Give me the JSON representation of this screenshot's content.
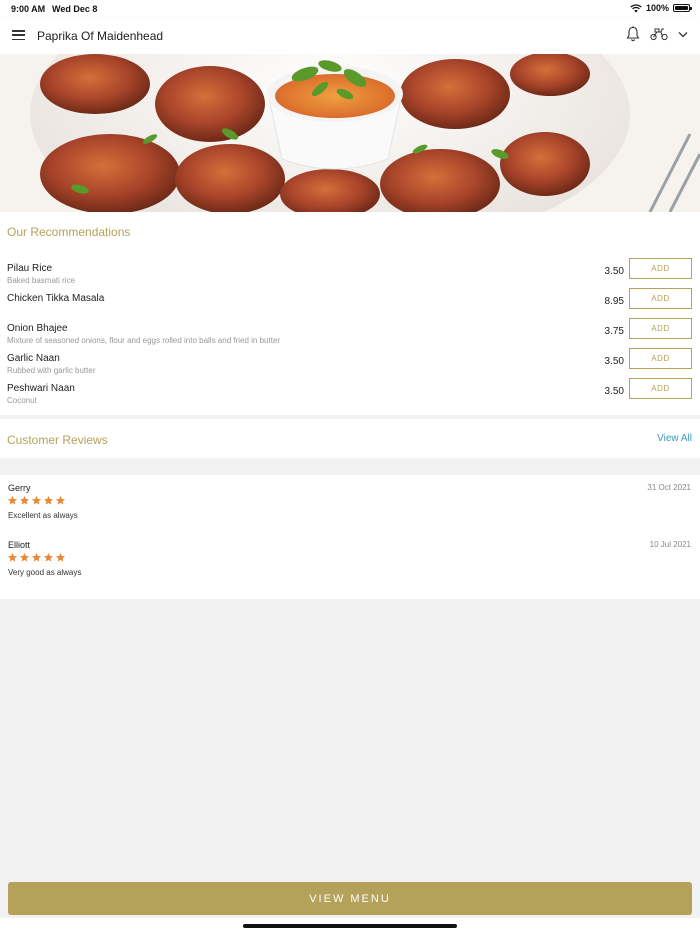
{
  "status": {
    "time": "9:00 AM",
    "date": "Wed Dec 8",
    "battery": "100%"
  },
  "header": {
    "title": "Paprika Of Maidenhead"
  },
  "recommendations": {
    "title": "Our Recommendations",
    "add_label": "ADD",
    "items": [
      {
        "name": "Pilau Rice",
        "desc": "Baked basmati rice",
        "price": "3.50"
      },
      {
        "name": "Chicken Tikka Masala",
        "desc": "",
        "price": "8.95"
      },
      {
        "name": "Onion Bhajee",
        "desc": "Mixture of seasoned onions, flour and eggs rolled into balls and fried in butter",
        "price": "3.75"
      },
      {
        "name": "Garlic Naan",
        "desc": "Rubbed with garlic butter",
        "price": "3.50"
      },
      {
        "name": "Peshwari Naan",
        "desc": "Coconut",
        "price": "3.50"
      }
    ]
  },
  "reviews": {
    "title": "Customer Reviews",
    "view_all": "View All",
    "items": [
      {
        "name": "Gerry",
        "date": "31 Oct 2021",
        "rating": 5,
        "text": "Excellent as always"
      },
      {
        "name": "Elliott",
        "date": "10 Jul 2021",
        "rating": 5,
        "text": "Very good as always"
      }
    ]
  },
  "footer": {
    "view_menu": "VIEW MENU"
  },
  "colors": {
    "accent": "#b5a25a",
    "link": "#3a9cc0",
    "star": "#e8893a"
  },
  "icons": [
    "menu-icon",
    "bell-icon",
    "scooter-icon",
    "chevron-down-icon",
    "wifi-icon",
    "battery-icon",
    "star-icon"
  ]
}
